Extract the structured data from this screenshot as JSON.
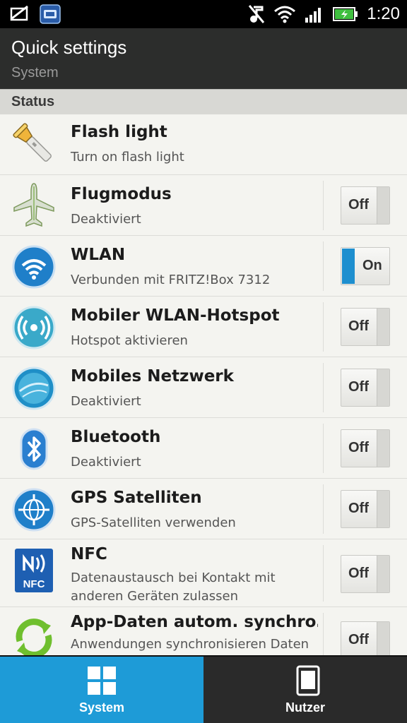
{
  "status_bar": {
    "time": "1:20"
  },
  "header": {
    "title": "Quick settings",
    "subtitle": "System"
  },
  "section": {
    "label": "Status"
  },
  "rows": [
    {
      "name": "Flash light",
      "desc": "Turn on flash light",
      "icon": "flashlight-icon"
    },
    {
      "name": "Flugmodus",
      "desc": "Deaktiviert",
      "icon": "airplane-icon",
      "toggle": "Off"
    },
    {
      "name": "WLAN",
      "desc": "Verbunden mit FRITZ!Box 7312",
      "icon": "wifi-icon",
      "toggle": "On"
    },
    {
      "name": "Mobiler WLAN-Hotspot",
      "desc": "Hotspot aktivieren",
      "icon": "hotspot-icon",
      "toggle": "Off"
    },
    {
      "name": "Mobiles Netzwerk",
      "desc": "Deaktiviert",
      "icon": "mobile-network-icon",
      "toggle": "Off"
    },
    {
      "name": "Bluetooth",
      "desc": "Deaktiviert",
      "icon": "bluetooth-icon",
      "toggle": "Off"
    },
    {
      "name": "GPS Satelliten",
      "desc": "GPS-Satelliten verwenden",
      "icon": "gps-icon",
      "toggle": "Off"
    },
    {
      "name": "NFC",
      "desc": "Datenaustausch bei Kontakt mit anderen Geräten zulassen",
      "icon": "nfc-icon",
      "toggle": "Off",
      "icon_text": "NFC"
    },
    {
      "name": "App-Daten autom. synchro…",
      "desc": "Anwendungen synchronisieren Daten",
      "icon": "sync-icon",
      "toggle": "Off"
    }
  ],
  "bottom_tabs": [
    {
      "label": "System",
      "icon": "grid-icon",
      "active": true
    },
    {
      "label": "Nutzer",
      "icon": "phone-icon",
      "active": false
    }
  ],
  "colors": {
    "accent": "#1e9bd7",
    "header_bg": "#2c2d2c",
    "toggle_on": "#1e8fcf"
  }
}
